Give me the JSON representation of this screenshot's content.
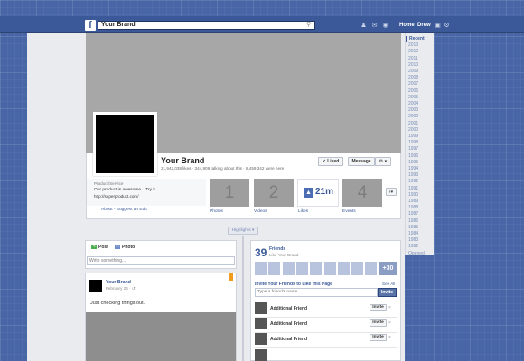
{
  "header": {
    "logo": "f",
    "search_value": "Your Brand",
    "search_icon": "search-icon",
    "nav": [
      "Home",
      "Drew"
    ]
  },
  "timeline_years": [
    "Recent",
    "2013",
    "2012",
    "2011",
    "2010",
    "2009",
    "2008",
    "2007",
    "2006",
    "2005",
    "2004",
    "2003",
    "2002",
    "2001",
    "2000",
    "1999",
    "1998",
    "1997",
    "1996",
    "1995",
    "1994",
    "1993",
    "1992",
    "1991",
    "1990",
    "1989",
    "1988",
    "1987",
    "1986",
    "1985",
    "1984",
    "1983",
    "1982",
    "Opened"
  ],
  "page": {
    "name": "Your Brand",
    "stats": "21,942,038 likes · 344,909 talking about this · 8,459,342 were here",
    "liked_label": "✔ Liked",
    "message_label": "Message",
    "settings_label": "⚙ ▾",
    "category": "Product/Service",
    "tagline": "Our product is awesome... Try it",
    "website": "http://superproduct.com/",
    "about_link": "About - Suggest an Edit",
    "tiles": [
      {
        "number": "1",
        "label": "Photos"
      },
      {
        "number": "2",
        "label": "Videos"
      },
      {
        "number": "21m",
        "label": "Likes"
      },
      {
        "number": "4",
        "label": "Events"
      }
    ],
    "more_tiles": "›▾"
  },
  "highlights_label": "Highlights ▾",
  "composer": {
    "post_tab": "Post",
    "photo_tab": "Photo",
    "placeholder": "Write something..."
  },
  "post": {
    "author": "Your Brand",
    "date": "February 26 · ↺",
    "text": "Just checking things out."
  },
  "friends": {
    "count": "39",
    "title": "Friends",
    "subtitle": "Like Your Brand",
    "more": "+30",
    "invite_title": "Invite Your Friends to Like this Page",
    "see_all": "See All",
    "input_placeholder": "Type a friend's name...",
    "invite_button": "Invite",
    "rows": [
      {
        "name": "Additional Friend",
        "invite": "Invite",
        "close": "×"
      },
      {
        "name": "Additional Friend",
        "invite": "Invite",
        "close": "×"
      },
      {
        "name": "Additional Friend",
        "invite": "Invite",
        "close": "×"
      }
    ]
  }
}
